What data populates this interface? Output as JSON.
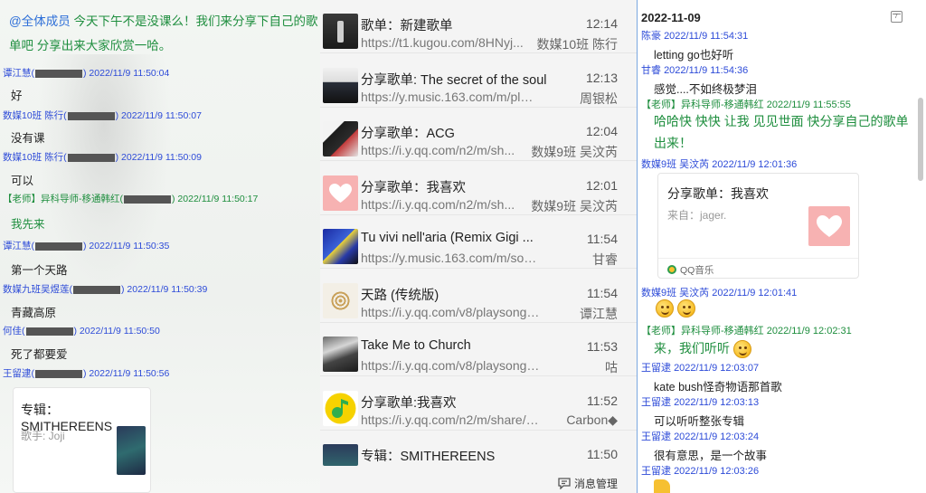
{
  "left": {
    "top_text": {
      "at": "@全体成员",
      "text": " 今天下午不是没课么！我们来分享下自己的歌单吧  分享出来大家欣赏一哈。"
    },
    "messages": [
      {
        "sender": "谭江慧(",
        "time": "2022/11/9 11:50:04",
        "body": "好",
        "teacher": false,
        "green": false
      },
      {
        "sender": "数媒10班 陈行(",
        "time": "2022/11/9 11:50:07",
        "body": "没有课",
        "teacher": false,
        "green": false
      },
      {
        "sender": "数媒10班 陈行(",
        "time": "2022/11/9 11:50:09",
        "body": "可以",
        "teacher": false,
        "green": false
      },
      {
        "sender": "【老师】异科导师-移通韩红(",
        "time": "2022/11/9 11:50:17",
        "body": "我先来",
        "teacher": true,
        "green": true
      },
      {
        "sender": "谭江慧(",
        "time": "2022/11/9 11:50:35",
        "body": "第一个天路",
        "teacher": false,
        "green": false
      },
      {
        "sender": "数媒九班吴煜莲(",
        "time": "2022/11/9 11:50:39",
        "body": "青藏高原",
        "teacher": false,
        "green": false
      },
      {
        "sender": "何佳(",
        "time": "2022/11/9 11:50:50",
        "body": "死了都要爱",
        "teacher": false,
        "green": false
      },
      {
        "sender": "王留逮(",
        "time": "2022/11/9 11:50:56",
        "body": "",
        "teacher": false,
        "green": false
      }
    ],
    "card": {
      "title": "专辑：SMITHEREENS",
      "singer": "歌手: Joji"
    }
  },
  "middle": {
    "items": [
      {
        "title": "歌单：新建歌单",
        "time": "12:14",
        "url": "https://t1.kugou.com/8HNyj...",
        "who": "数媒10班 陈行",
        "thumb": "th-dark"
      },
      {
        "title": "分享歌单: The secret of the soul",
        "time": "12:13",
        "url": "https://y.music.163.com/m/playlist...",
        "who": "周银松",
        "thumb": "th-forest"
      },
      {
        "title": "分享歌单：ACG",
        "time": "12:04",
        "url": "https://i.y.qq.com/n2/m/sh...",
        "who": "数媒9班 吴汶芮",
        "thumb": "th-acg"
      },
      {
        "title": "分享歌单：我喜欢",
        "time": "12:01",
        "url": "https://i.y.qq.com/n2/m/sh...",
        "who": "数媒9班 吴汶芮",
        "thumb": "th-heart"
      },
      {
        "title": "Tu vivi nell'aria (Remix Gigi ...",
        "time": "11:54",
        "url": "https://y.music.163.com/m/song?id=...",
        "who": "甘睿",
        "thumb": "th-tu"
      },
      {
        "title": "天路 (传统版)",
        "time": "11:54",
        "url": "https://i.y.qq.com/v8/playsong.htm...",
        "who": "谭江慧",
        "thumb": "th-tianlu"
      },
      {
        "title": "Take Me to Church",
        "time": "11:53",
        "url": "https://i.y.qq.com/v8/playsong.html?pl...",
        "who": "咕",
        "thumb": "th-church"
      },
      {
        "title": "分享歌单:我喜欢",
        "time": "11:52",
        "url": "https://i.y.qq.com/n2/m/share/d...",
        "who": "Carbon◆",
        "thumb": "th-qq"
      },
      {
        "title": "专辑：SMITHEREENS",
        "time": "11:50",
        "url": "",
        "who": "",
        "thumb": "th-smith"
      }
    ],
    "manage_label": "消息管理"
  },
  "right": {
    "date": "2022-11-09",
    "messages": [
      {
        "sender": "陈豪",
        "time": "2022/11/9 11:54:31",
        "body": "letting go也好听",
        "teacher": false
      },
      {
        "sender": "甘睿",
        "time": "2022/11/9 11:54:36",
        "body": "感觉....不如终极梦泪",
        "teacher": false
      },
      {
        "sender": "【老师】异科导师-移通韩红",
        "time": "2022/11/9 11:55:55",
        "body": "哈哈快 快快  让我 见见世面   快分享自己的歌单出来！",
        "teacher": true
      },
      {
        "sender": "数媒9班 吴汶芮",
        "time": "2022/11/9 12:01:36",
        "body": "",
        "teacher": false
      },
      {
        "sender": "数媒9班 吴汶芮",
        "time": "2022/11/9 12:01:41",
        "body": "",
        "teacher": false
      },
      {
        "sender": "【老师】异科导师-移通韩红",
        "time": "2022/11/9 12:02:31",
        "body": "来，我们听听",
        "teacher": true
      },
      {
        "sender": "王留逮",
        "time": "2022/11/9 12:03:07",
        "body": "kate bush怪奇物语那首歌",
        "teacher": false
      },
      {
        "sender": "王留逮",
        "time": "2022/11/9 12:03:13",
        "body": "可以听听整张专辑",
        "teacher": false
      },
      {
        "sender": "王留逮",
        "time": "2022/11/9 12:03:24",
        "body": "很有意思，是一个故事",
        "teacher": false
      },
      {
        "sender": "王留逮",
        "time": "2022/11/9 12:03:26",
        "body": "",
        "teacher": false
      }
    ],
    "card": {
      "title": "分享歌单：我喜欢",
      "source": "来自：jager.",
      "app": "QQ音乐"
    }
  }
}
